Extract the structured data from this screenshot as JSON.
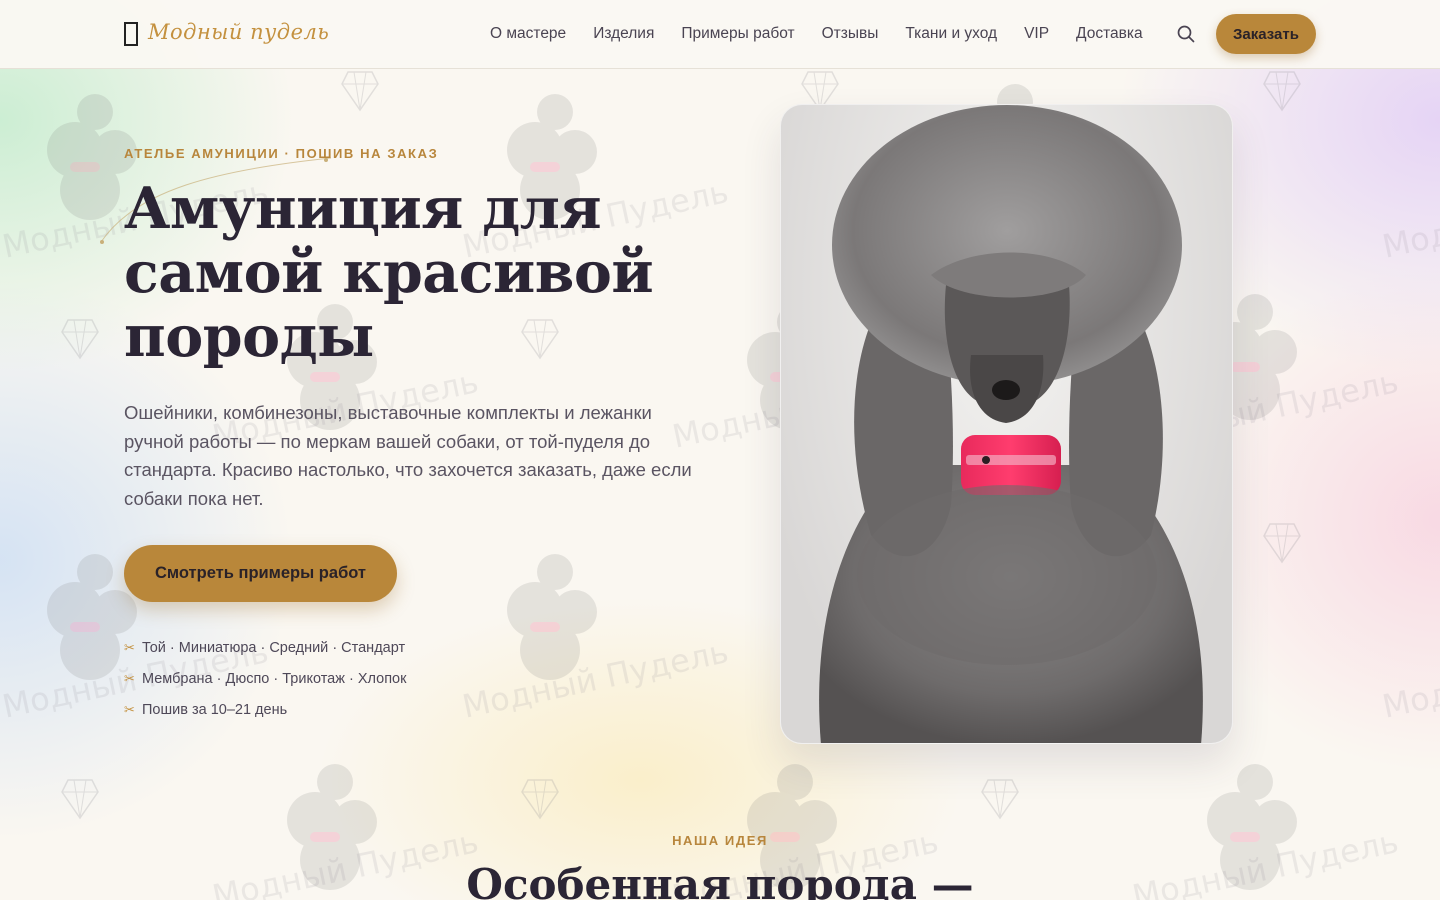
{
  "brand": {
    "name": "Модный пудель"
  },
  "nav": {
    "items": [
      "О мастере",
      "Изделия",
      "Примеры работ",
      "Отзывы",
      "Ткани и уход",
      "VIP",
      "Доставка"
    ],
    "search_icon": "search-icon",
    "order_label": "Заказать"
  },
  "watermark": {
    "text": "Модный Пудель"
  },
  "hero": {
    "eyebrow": "АТЕЛЬЕ АМУНИЦИИ · ПОШИВ НА ЗАКАЗ",
    "title_lines": [
      "Амуниция для",
      "самой красивой",
      "породы"
    ],
    "lead": "Ошейники, комбинезоны, выставочные комплекты и лежанки ручной работы — по меркам вашей собаки, от той-пуделя до стандарта. Красиво настолько, что захочется заказать, даже если собаки пока нет.",
    "cta_label": "Смотреть примеры работ",
    "features": [
      "Той · Миниатюра · Средний · Стандарт",
      "Мембрана · Дюспо · Трикотаж · Хлопок",
      "Пошив за 10–21 день"
    ],
    "feature_icon": "scissors-icon",
    "image_subject": "grey-poodle-with-pink-collar"
  },
  "idea": {
    "eyebrow": "НАША ИДЕЯ",
    "title": "Особенная порода —"
  },
  "colors": {
    "accent": "#b9873a",
    "accent_text": "#c4913f",
    "heading": "#2b2535",
    "body_text": "#5a5462"
  }
}
